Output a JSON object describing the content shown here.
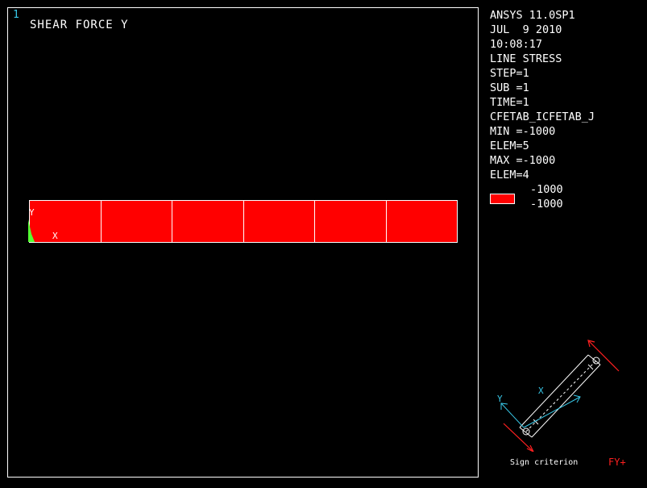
{
  "viewport": {
    "window_number": "1",
    "title": "SHEAR FORCE Y",
    "axis_labels": {
      "y": "Y",
      "x": "X"
    },
    "elements": [
      {
        "color": "#ff0000"
      },
      {
        "color": "#ff0000"
      },
      {
        "color": "#ff0000"
      },
      {
        "color": "#ff0000"
      },
      {
        "color": "#ff0000"
      },
      {
        "color": "#ff0000"
      }
    ]
  },
  "info": {
    "lines": [
      "ANSYS 11.0SP1",
      "JUL  9 2010",
      "10:08:17",
      "LINE STRESS",
      "STEP=1",
      "SUB =1",
      "TIME=1",
      "CFETAB_ICFETAB_J",
      "MIN =-1000",
      "ELEM=5",
      "MAX =-1000",
      "ELEM=4"
    ]
  },
  "legend": {
    "swatch_color": "#ff0000",
    "value_top": "-1000",
    "value_bottom": "-1000"
  },
  "sign_criterion": {
    "label": "Sign criterion",
    "force": "FY+",
    "axis_x": "X",
    "axis_y": "Y"
  },
  "colors": {
    "background": "#000000",
    "contour": "#ff0000",
    "triad_green": "#55ff33",
    "window_number": "#38c8e8",
    "sign_arrow": "#ff2020",
    "sign_axis": "#38c8e8"
  }
}
